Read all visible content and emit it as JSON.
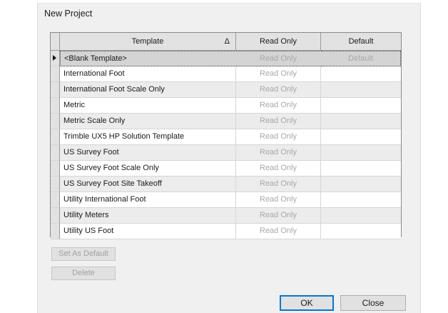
{
  "window": {
    "title": "New Project"
  },
  "grid": {
    "columns": {
      "template": "Template",
      "sort_glyph": "Δ",
      "read_only": "Read Only",
      "default": "Default"
    },
    "rows": [
      {
        "template": "<Blank Template>",
        "read_only": "Read Only",
        "default": "Default",
        "selected": true
      },
      {
        "template": "International Foot",
        "read_only": "Read Only",
        "default": ""
      },
      {
        "template": "International Foot Scale Only",
        "read_only": "Read Only",
        "default": ""
      },
      {
        "template": "Metric",
        "read_only": "Read Only",
        "default": ""
      },
      {
        "template": "Metric Scale Only",
        "read_only": "Read Only",
        "default": ""
      },
      {
        "template": "Trimble UX5 HP Solution Template",
        "read_only": "Read Only",
        "default": ""
      },
      {
        "template": "US Survey Foot",
        "read_only": "Read Only",
        "default": ""
      },
      {
        "template": "US Survey Foot Scale Only",
        "read_only": "Read Only",
        "default": ""
      },
      {
        "template": "US Survey Foot Site Takeoff",
        "read_only": "Read Only",
        "default": ""
      },
      {
        "template": "Utility International Foot",
        "read_only": "Read Only",
        "default": ""
      },
      {
        "template": "Utility Meters",
        "read_only": "Read Only",
        "default": ""
      },
      {
        "template": "Utility US Foot",
        "read_only": "Read Only",
        "default": ""
      }
    ]
  },
  "buttons": {
    "set_as_default": "Set As Default",
    "delete": "Delete",
    "ok": "OK",
    "close": "Close"
  },
  "icons": {
    "sort": "sort-ascending-icon",
    "row_pointer": "current-row-pointer-icon"
  },
  "colors": {
    "accent": "#0078d7",
    "disabled_text": "#a8a8a8",
    "dialog_bg": "#f0f0f0"
  }
}
